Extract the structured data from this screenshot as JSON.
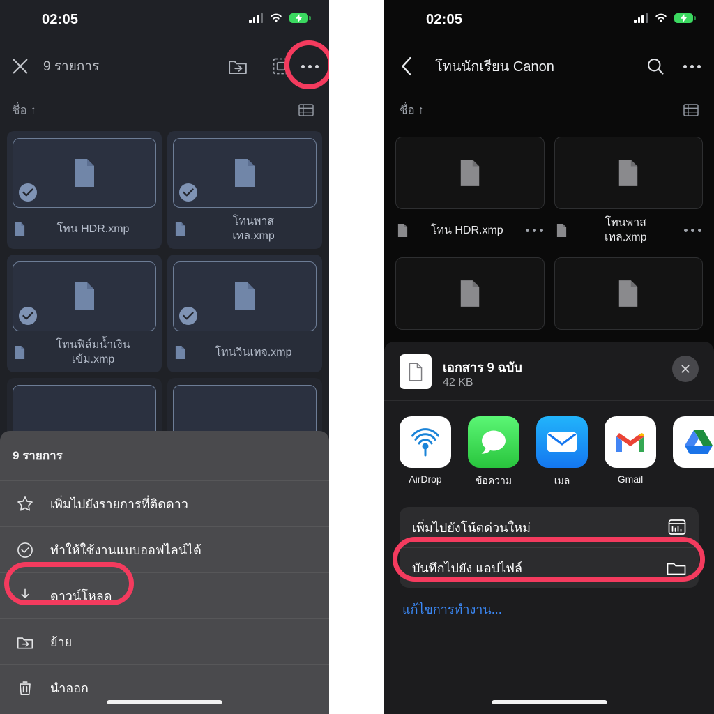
{
  "status_bar": {
    "time": "02:05",
    "cellular_icon": "cellular-signal-icon",
    "wifi_icon": "wifi-icon",
    "battery_icon": "battery-charging-icon"
  },
  "left_panel": {
    "nav": {
      "close_icon": "close-icon",
      "selection_count": "9 รายการ",
      "move_icon": "move-to-folder-icon",
      "select_all_icon": "select-all-icon",
      "more_icon": "more-options-icon"
    },
    "sort": {
      "label": "ชื่อ ↑",
      "view_toggle_icon": "list-view-icon"
    },
    "files": [
      {
        "name": "โทน HDR.xmp",
        "selected": true
      },
      {
        "name": "โทนพาส\nเทล.xmp",
        "selected": true
      },
      {
        "name": "โทนฟิล์มน้ำเงิน\nเข้ม.xmp",
        "selected": true
      },
      {
        "name": "โทนวินเทจ.xmp",
        "selected": true
      }
    ],
    "sheet": {
      "title": "9 รายการ",
      "items": [
        {
          "label": "เพิ่มไปยังรายการที่ติดดาว",
          "icon": "star-icon"
        },
        {
          "label": "ทำให้ใช้งานแบบออฟไลน์ได้",
          "icon": "offline-check-icon"
        },
        {
          "label": "ดาวน์โหลด",
          "icon": "download-icon",
          "highlighted": true
        },
        {
          "label": "ย้าย",
          "icon": "move-to-folder-icon"
        },
        {
          "label": "นำออก",
          "icon": "trash-icon"
        }
      ]
    }
  },
  "right_panel": {
    "nav": {
      "back_icon": "back-chevron-icon",
      "title": "โทนนักเรียน Canon",
      "search_icon": "search-icon",
      "more_icon": "more-options-icon"
    },
    "sort": {
      "label": "ชื่อ ↑",
      "view_toggle_icon": "list-view-icon"
    },
    "files": [
      {
        "name": "โทน HDR.xmp"
      },
      {
        "name": "โทนพาส\nเทล.xmp"
      },
      {
        "name": ""
      },
      {
        "name": ""
      }
    ],
    "share_sheet": {
      "doc_icon": "document-icon",
      "title": "เอกสาร 9 ฉบับ",
      "size": "42 KB",
      "close_icon": "close-icon",
      "apps": [
        {
          "label": "AirDrop",
          "icon": "airdrop-icon"
        },
        {
          "label": "ข้อความ",
          "icon": "messages-icon"
        },
        {
          "label": "เมล",
          "icon": "mail-icon"
        },
        {
          "label": "Gmail",
          "icon": "gmail-icon"
        },
        {
          "label": "",
          "icon": "drive-icon"
        }
      ],
      "actions": [
        {
          "label": "เพิ่มไปยังโน้ตด่วนใหม่",
          "icon": "quick-note-icon"
        },
        {
          "label": "บันทึกไปยัง แอปไฟล์",
          "icon": "folder-icon",
          "highlighted": true
        }
      ],
      "edit_actions_label": "แก้ไขการทำงาน..."
    }
  },
  "colors": {
    "accent_highlight": "#f43b5e",
    "selection_blue": "#7f93b4",
    "link_blue": "#3b88f5",
    "battery_green": "#3bd960"
  }
}
